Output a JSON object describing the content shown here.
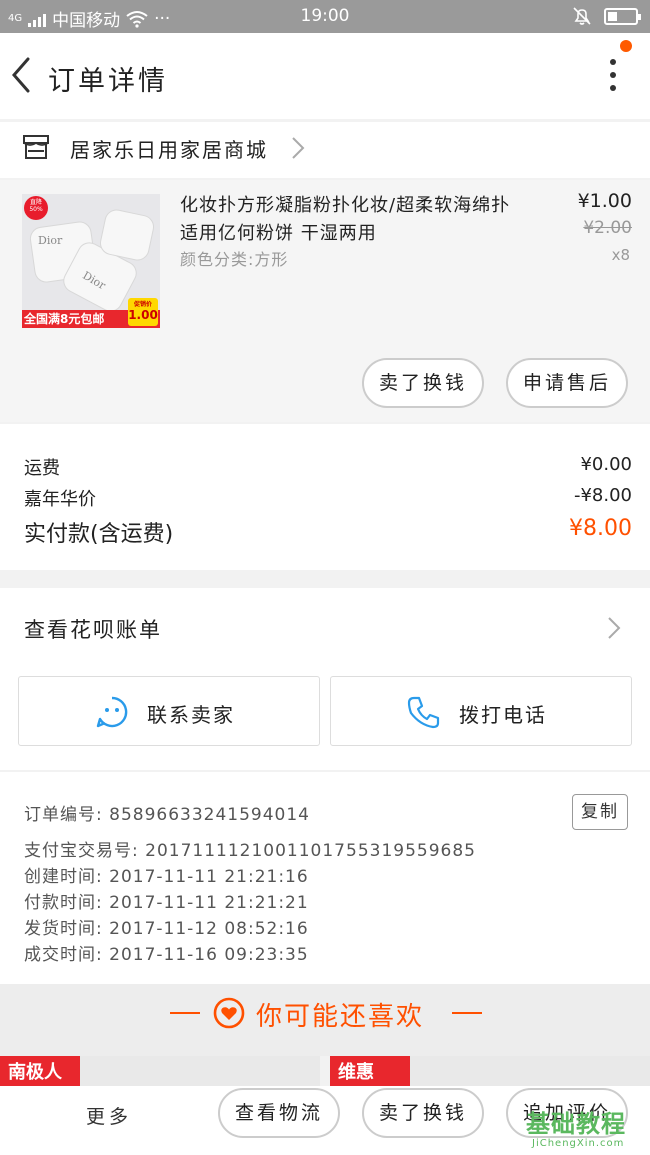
{
  "status_bar": {
    "carrier": "中国移动",
    "dots": "···",
    "time": "19:00",
    "signal_label": "4G"
  },
  "header": {
    "title": "订单详情"
  },
  "shop": {
    "name": "居家乐日用家居商城"
  },
  "item": {
    "title": "化妆扑方形凝脂粉扑化妆/超柔软海绵扑适用亿何粉饼 干湿两用",
    "sku": "颜色分类:方形",
    "price": "¥1.00",
    "original_price": "¥2.00",
    "quantity": "x8",
    "image": {
      "badge": "直降 50%",
      "brand_text": "Dior",
      "promo": "全国满8元包邮",
      "price_tag_label": "促销价",
      "price_tag": "1.00"
    },
    "buttons": {
      "refund": "卖了换钱",
      "after_sale": "申请售后"
    }
  },
  "fees": {
    "shipping_label": "运费",
    "shipping_value": "¥0.00",
    "carnival_label": "嘉年华价",
    "carnival_value": "-¥8.00",
    "total_label": "实付款(含运费)",
    "total_value": "¥8.00"
  },
  "huabei": {
    "label": "查看花呗账单",
    "contact_seller": "联系卖家",
    "call": "拨打电话"
  },
  "order_info": {
    "order_no": "订单编号: 85896633241594014",
    "alipay_no": "支付宝交易号: 2017111121001101755319559685",
    "created": "创建时间: 2017-11-11  21:21:16",
    "paid": "付款时间: 2017-11-11  21:21:21",
    "shipped": "发货时间: 2017-11-12  08:52:16",
    "completed": "成交时间: 2017-11-16  09:23:35",
    "copy_label": "复制"
  },
  "recommend": {
    "title": "你可能还喜欢",
    "card_left_tag": "南极人",
    "card_right_tag": "维惠"
  },
  "bottom_bar": {
    "more": "更多",
    "logistics": "查看物流",
    "sell": "卖了换钱",
    "review": "追加评价"
  },
  "watermark": {
    "cn": "基础教程",
    "en": "JiChengXin.com"
  },
  "colors": {
    "accent": "#ff5000",
    "status_bar": "#9a9a9a",
    "icon_blue": "#2a9bea",
    "watermark": "#5bb85f"
  }
}
